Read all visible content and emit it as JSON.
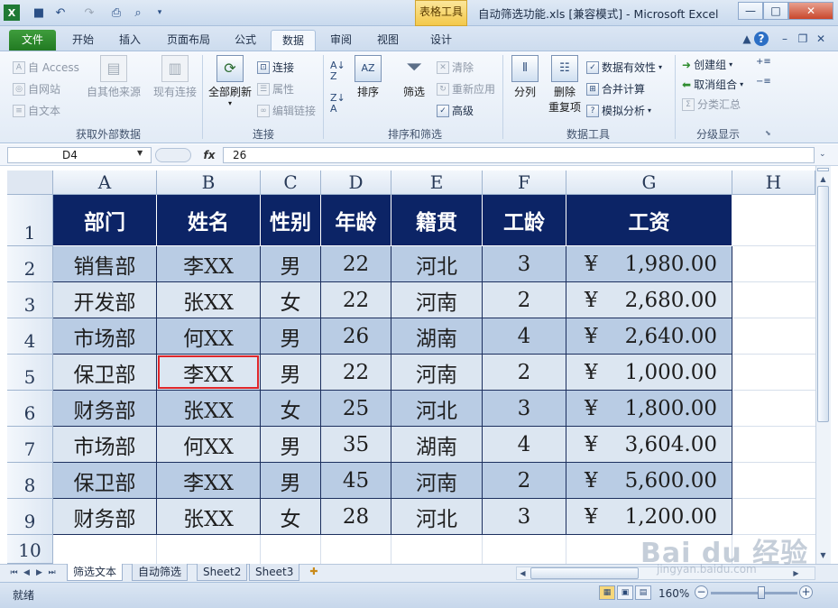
{
  "titlebar": {
    "context_tab": "表格工具",
    "title": "自动筛选功能.xls  [兼容模式] - Microsoft Excel",
    "qat_icons": [
      "excel-logo-icon",
      "save-icon",
      "undo-icon",
      "redo-icon",
      "print-icon",
      "print-preview-icon",
      "customize-icon"
    ],
    "minimize": "—",
    "maximize": "□",
    "close": "✕"
  },
  "tabs": [
    {
      "label": "文件"
    },
    {
      "label": "开始"
    },
    {
      "label": "插入"
    },
    {
      "label": "页面布局"
    },
    {
      "label": "公式"
    },
    {
      "label": "数据"
    },
    {
      "label": "审阅"
    },
    {
      "label": "视图"
    },
    {
      "label": "设计"
    }
  ],
  "active_tab": "数据",
  "ribbon": {
    "external": {
      "label": "获取外部数据",
      "access": "自 Access",
      "web": "自网站",
      "text": "自文本",
      "other": "自其他来源",
      "existing": "现有连接"
    },
    "connections": {
      "label": "连接",
      "refresh_all": "全部刷新",
      "connections": "连接",
      "properties": "属性",
      "edit_links": "编辑链接"
    },
    "sortfilter": {
      "label": "排序和筛选",
      "sort": "排序",
      "filter": "筛选",
      "clear": "清除",
      "reapply": "重新应用",
      "advanced": "高级"
    },
    "datatools": {
      "label": "数据工具",
      "split": "分列",
      "remove_dup_1": "删除",
      "remove_dup_2": "重复项",
      "validation": "数据有效性",
      "consolidate": "合并计算",
      "whatif": "模拟分析"
    },
    "outline": {
      "label": "分级显示",
      "group": "创建组",
      "ungroup": "取消组合",
      "subtotal": "分类汇总"
    }
  },
  "formula_bar": {
    "name_box": "D4",
    "fx": "fx",
    "value": "26"
  },
  "columns": [
    "A",
    "B",
    "C",
    "D",
    "E",
    "F",
    "G",
    "H"
  ],
  "rows": [
    "1",
    "2",
    "3",
    "4",
    "5",
    "6",
    "7",
    "8",
    "9",
    "10"
  ],
  "table": {
    "headers": [
      "部门",
      "姓名",
      "性别",
      "年龄",
      "籍贯",
      "工龄",
      "工资"
    ],
    "currency": "¥",
    "rows": [
      [
        "销售部",
        "李XX",
        "男",
        "22",
        "河北",
        "3",
        "1,980.00"
      ],
      [
        "开发部",
        "张XX",
        "女",
        "22",
        "河南",
        "2",
        "2,680.00"
      ],
      [
        "市场部",
        "何XX",
        "男",
        "26",
        "湖南",
        "4",
        "2,640.00"
      ],
      [
        "保卫部",
        "李XX",
        "男",
        "22",
        "河南",
        "2",
        "1,000.00"
      ],
      [
        "财务部",
        "张XX",
        "女",
        "25",
        "河北",
        "3",
        "1,800.00"
      ],
      [
        "市场部",
        "何XX",
        "男",
        "35",
        "湖南",
        "4",
        "3,604.00"
      ],
      [
        "保卫部",
        "李XX",
        "男",
        "45",
        "河南",
        "2",
        "5,600.00"
      ],
      [
        "财务部",
        "张XX",
        "女",
        "28",
        "河北",
        "3",
        "1,200.00"
      ]
    ]
  },
  "sheets": [
    "筛选文本",
    "自动筛选",
    "Sheet2",
    "Sheet3"
  ],
  "status": {
    "ready": "就绪",
    "zoom": "160%"
  },
  "watermark": {
    "main": "Bai du 经验",
    "sub": "jingyan.baidu.com"
  },
  "colors": {
    "header_fill": "#0c2466",
    "band_dark": "#b9cce4",
    "band_light": "#dce6f1",
    "selection": "#e0262a",
    "file_tab": "#2f8c2f"
  }
}
